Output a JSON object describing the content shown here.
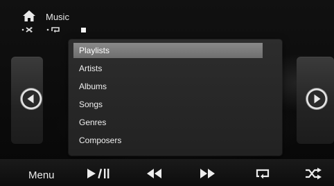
{
  "header": {
    "title": "Music",
    "shuffle_indicator": "• ✖",
    "repeat_indicator": "• ⟲",
    "home_icon": "home-icon"
  },
  "menu": {
    "selected_index": 0,
    "items": [
      {
        "label": "Playlists"
      },
      {
        "label": "Artists"
      },
      {
        "label": "Albums"
      },
      {
        "label": "Songs"
      },
      {
        "label": "Genres"
      },
      {
        "label": "Composers"
      }
    ]
  },
  "controls": {
    "menu_label": "Menu",
    "icons": [
      "play-pause-icon",
      "rewind-icon",
      "fast-forward-icon",
      "repeat-icon",
      "shuffle-icon"
    ]
  },
  "colors": {
    "background": "#0b0b0b",
    "highlight": "#7c7c7c",
    "text": "#f0f0f0"
  }
}
